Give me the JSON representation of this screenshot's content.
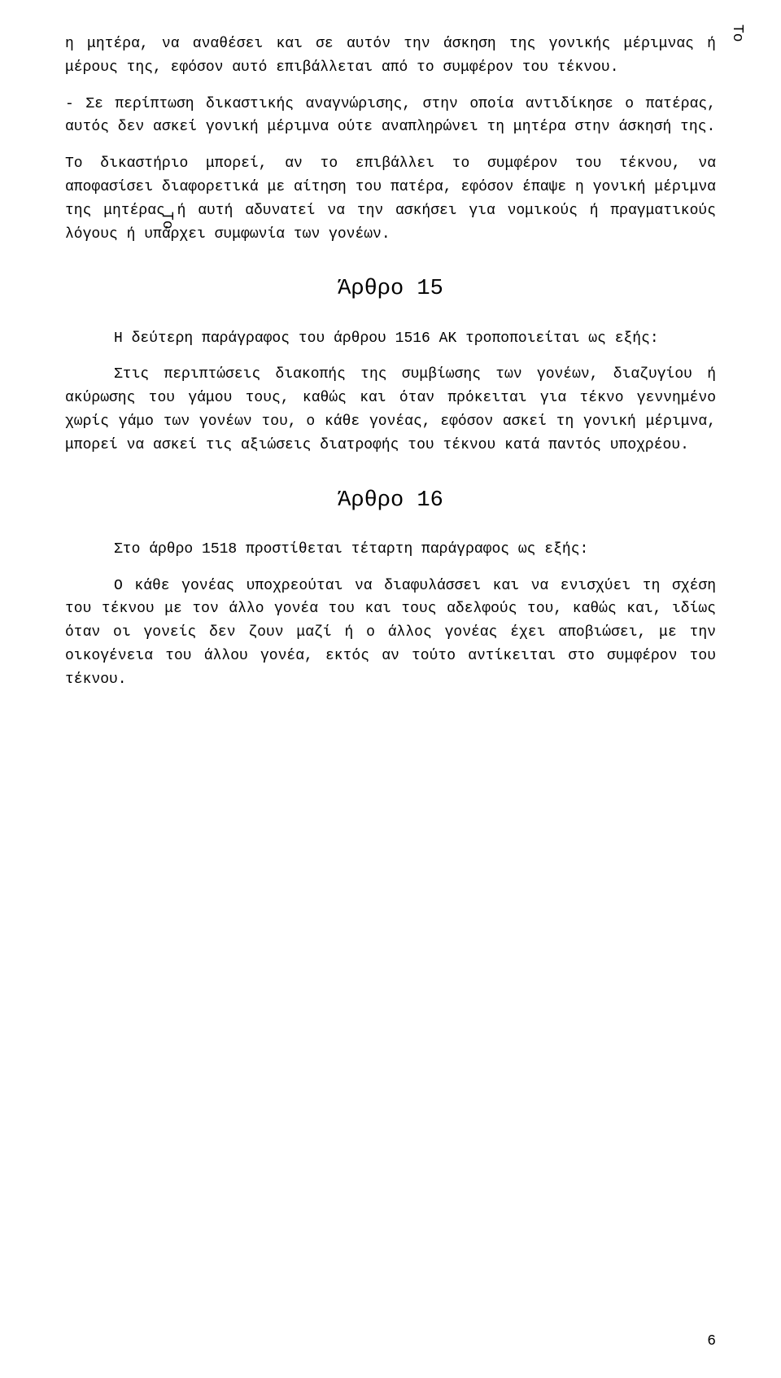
{
  "page": {
    "top_right_label": "To",
    "left_label": "To",
    "page_number": "6",
    "paragraphs": [
      {
        "id": "p1",
        "text": "η μητέρα, να αναθέσει και σε αυτόν την άσκηση της γονικής μέριμνας ή μέρους της, εφόσον αυτό επιβάλλεται από το συμφέρον του τέκνου."
      },
      {
        "id": "p2",
        "text": "- Σε περίπτωση δικαστικής αναγνώρισης, στην οποία αντιδίκησε ο πατέρας, αυτός δεν ασκεί γονική μέριμνα ούτε αναπληρώνει τη μητέρα στην άσκησή της."
      },
      {
        "id": "p3",
        "text": "Το δικαστήριο μπορεί, αν το επιβάλλει το συμφέρον του τέκνου, να αποφασίσει διαφορετικά με αίτηση του πατέρα, εφόσον έπαψε η γονική μέριμνα της μητέρας ή αυτή αδυνατεί να την ασκήσει για νομικούς ή πραγματικούς λόγους ή υπάρχει συμφωνία των γονέων."
      }
    ],
    "article15": {
      "heading": "Άρθρο 15",
      "paragraph1": "Η  δεύτερη  παράγραφος  του  άρθρου  1516  ΑΚ τροποποιείται ως εξής:",
      "paragraph2": "Στις  περιπτώσεις  διακοπής  της  συμβίωσης  των γονέων, διαζυγίου ή ακύρωσης του γάμου τους, καθώς και όταν πρόκειται για τέκνο γεννημένο χωρίς γάμο των γονέων του, ο κάθε γονέας, εφόσον ασκεί τη γονική μέριμνα, μπορεί να ασκεί τις αξιώσεις διατροφής του τέκνου κατά παντός υποχρέου."
    },
    "article16": {
      "heading": "Άρθρο 16",
      "paragraph1": "Στο άρθρο 1518 προστίθεται τέταρτη παράγραφος ως εξής:",
      "paragraph2": "Ο κάθε γονέας υποχρεούται να διαφυλάσσει και να ενισχύει τη σχέση του τέκνου με τον άλλο γονέα του και τους αδελφούς του, καθώς και, ιδίως όταν οι γονείς δεν ζουν μαζί ή ο άλλος γονέας έχει αποβιώσει, με την οικογένεια του άλλου γονέα, εκτός αν τούτο αντίκειται στο συμφέρον του τέκνου."
    }
  }
}
